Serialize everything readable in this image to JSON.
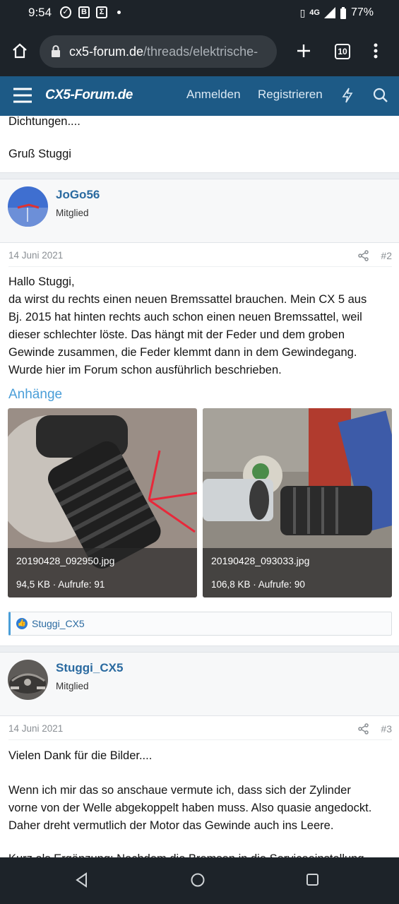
{
  "status": {
    "time": "9:54",
    "icon1": "✓",
    "icon2": "B",
    "icon3": "Σ",
    "network": "4G",
    "battery": "77%"
  },
  "browser": {
    "host": "cx5-forum.de",
    "path": "/threads/elektrische-",
    "tabs": "10"
  },
  "forum": {
    "logo": "CX5-Forum.de",
    "login": "Anmelden",
    "register": "Registrieren"
  },
  "prev_post": {
    "text1": "Dichtungen....",
    "text2": "Gruß Stuggi"
  },
  "post2": {
    "user": "JoGo56",
    "role": "Mitglied",
    "date": "14 Juni 2021",
    "num": "#2",
    "lines": [
      "Hallo Stuggi,",
      "da wirst du rechts einen neuen Bremssattel brauchen. Mein CX 5 aus",
      "Bj. 2015 hat hinten rechts auch schon einen neuen Bremssattel, weil",
      "dieser schlechter löste. Das hängt mit der Feder und dem groben",
      "Gewinde zusammen, die Feder klemmt dann in dem Gewindegang.",
      "Wurde hier im Forum schon ausführlich beschrieben."
    ],
    "attach_title": "Anhänge",
    "attachments": [
      {
        "name": "20190428_092950.jpg",
        "meta": "94,5 KB · Aufrufe: 91"
      },
      {
        "name": "20190428_093033.jpg",
        "meta": "106,8 KB · Aufrufe: 90"
      }
    ],
    "reaction": "Stuggi_CX5"
  },
  "post3": {
    "user": "Stuggi_CX5",
    "role": "Mitglied",
    "date": "14 Juni 2021",
    "num": "#3",
    "line1": "Vielen Dank für die Bilder....",
    "lines": [
      "Wenn ich mir das so anschaue vermute ich, dass sich der Zylinder",
      "vorne von der Welle abgekoppelt haben muss. Also quasie angedockt.",
      "Daher dreht vermutlich der Motor das Gewinde auch ins Leere."
    ],
    "cut_line": "Kurz als Ergänzung: Nachdem die Bremsen in die Serviceeinstellung"
  }
}
